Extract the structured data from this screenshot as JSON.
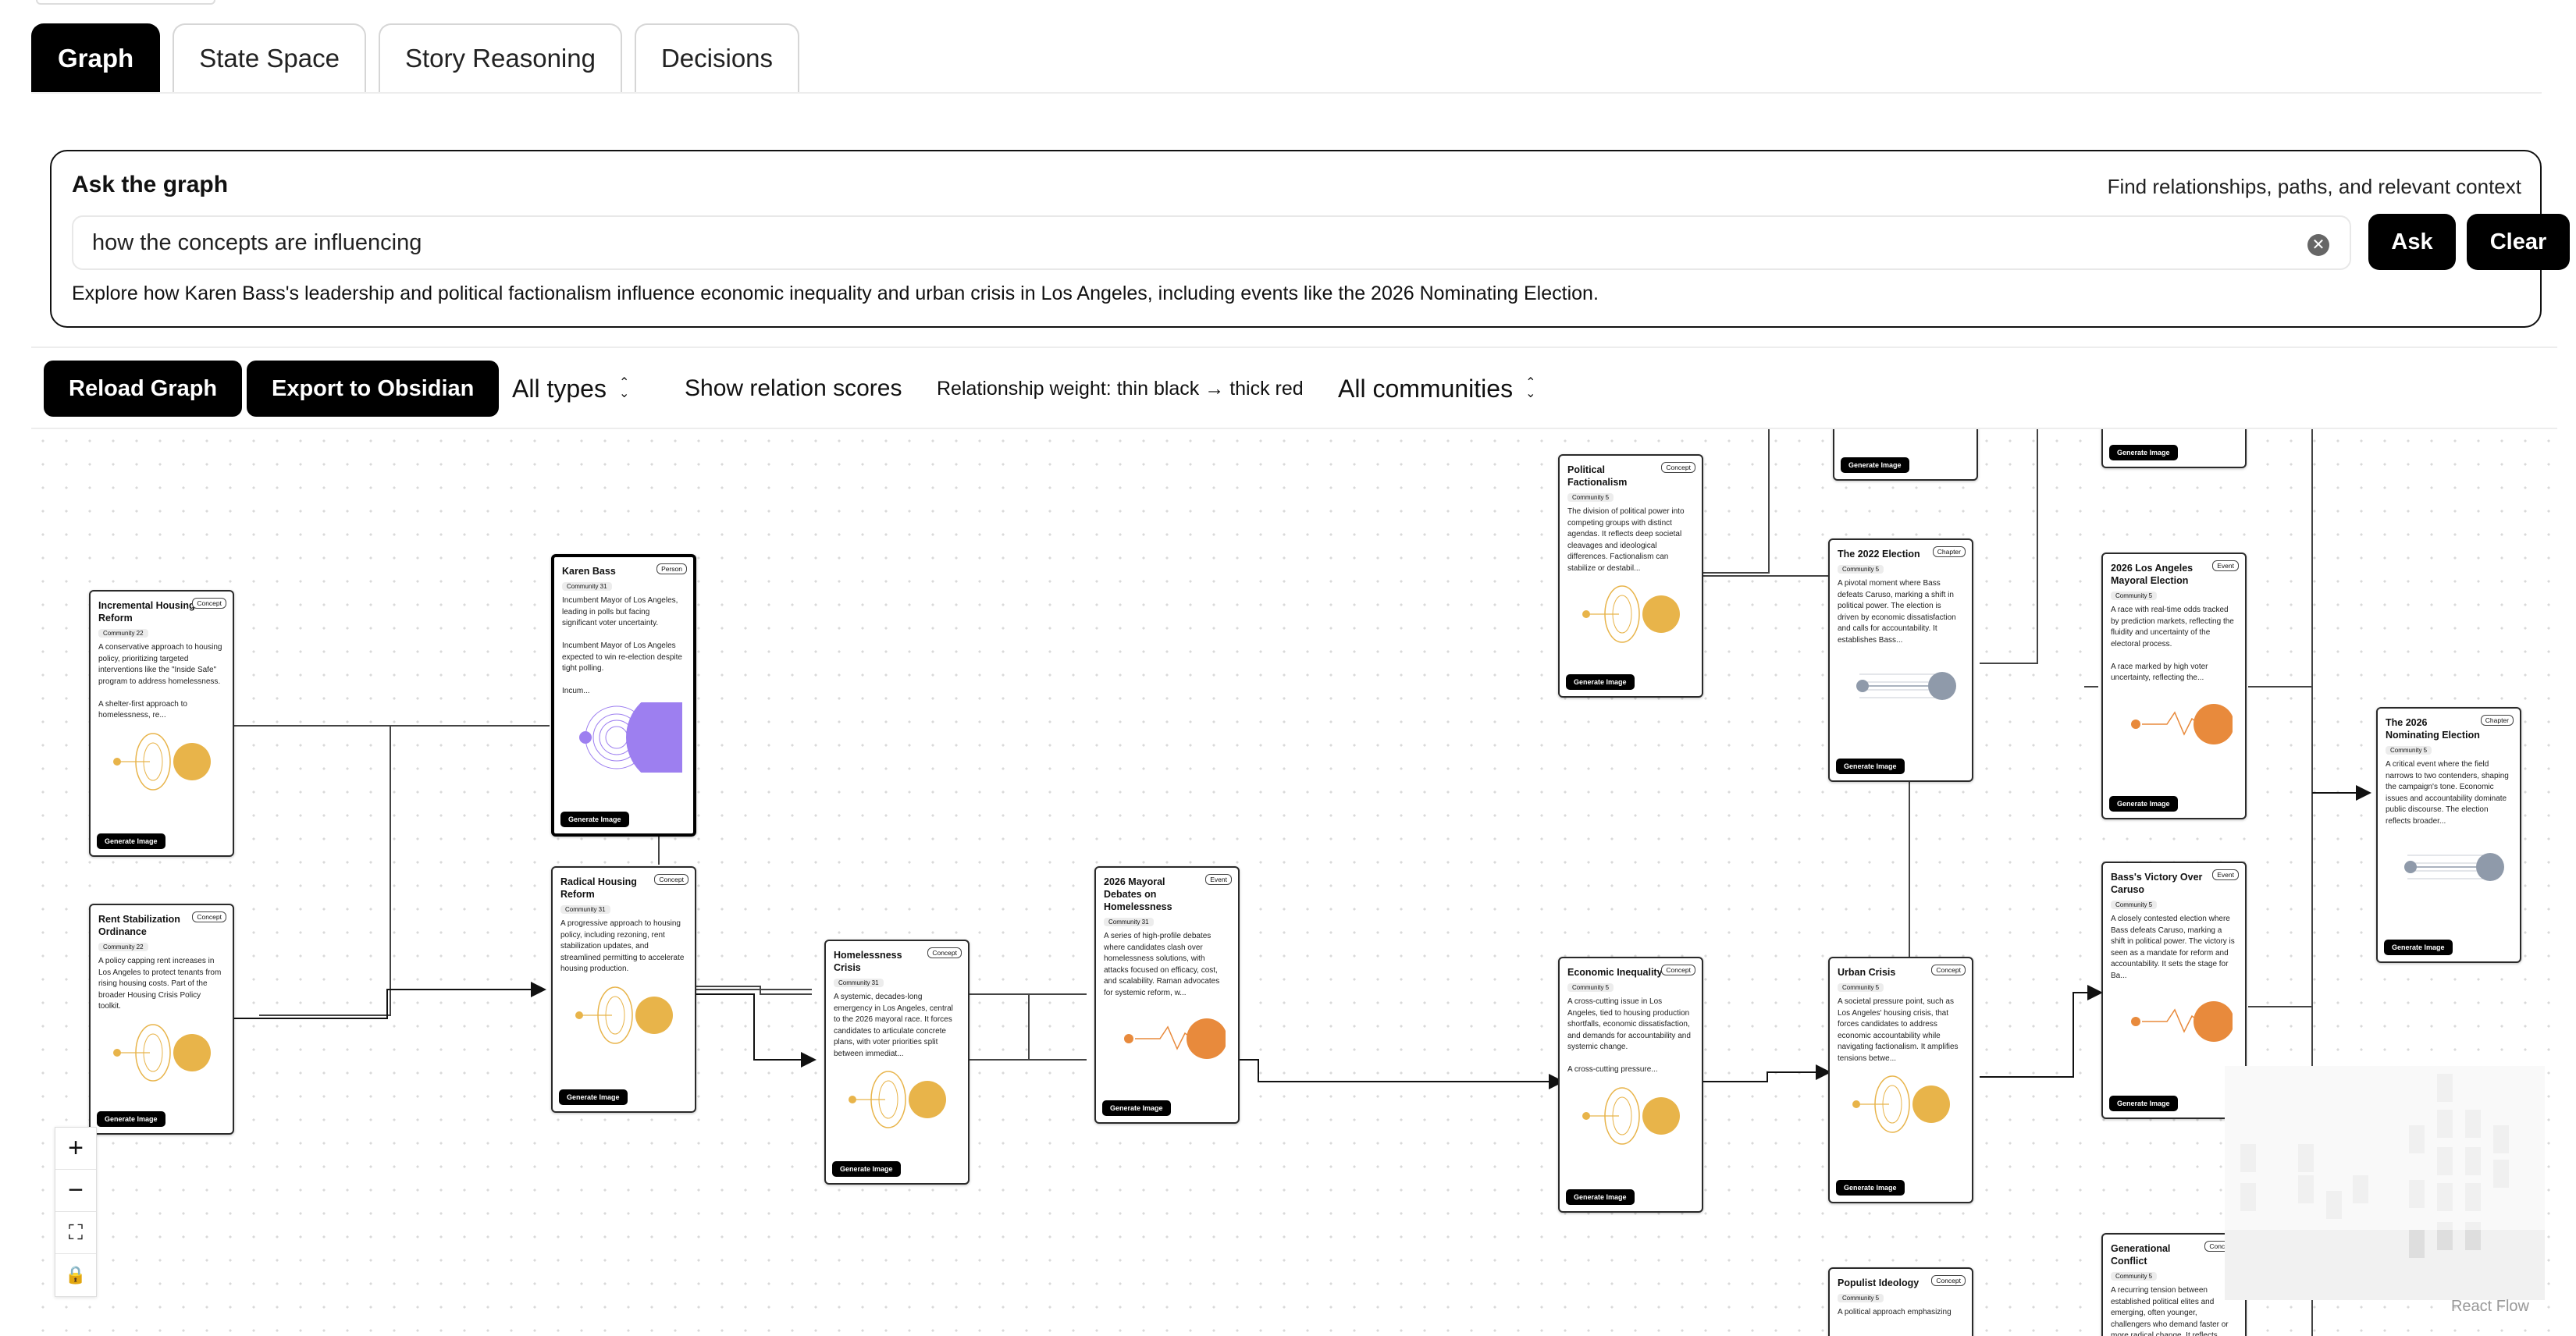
{
  "tabs": [
    {
      "label": "Graph",
      "active": true
    },
    {
      "label": "State Space"
    },
    {
      "label": "Story Reasoning"
    },
    {
      "label": "Decisions"
    }
  ],
  "ask": {
    "title": "Ask the graph",
    "hint": "Find relationships, paths, and relevant context",
    "query": "how the concepts are influencing",
    "ask_label": "Ask",
    "clear_label": "Clear",
    "summary": "Explore how Karen Bass's leadership and political factionalism influence economic inequality and urban crisis in Los Angeles, including events like the 2026 Nominating Election."
  },
  "toolbar": {
    "reload": "Reload Graph",
    "export": "Export to Obsidian",
    "types": "All types",
    "scores": "Show relation scores",
    "weight": "Relationship weight: thin black → thick red",
    "communities": "All communities"
  },
  "colors": {
    "orange": "#e8b44a",
    "deep_orange": "#e88a3c",
    "purple": "#9d7ff0",
    "slate": "#8f9aaa"
  },
  "nodes": [
    {
      "title": "Incremental Housing Reform",
      "type": "Concept",
      "community": "Community 22",
      "desc": "A conservative approach to housing policy, prioritizing targeted interventions like the \"Inside Safe\" program to address homelessness.\n\nA shelter-first approach to homelessness, re...",
      "art": "orange",
      "button": "Generate Image"
    },
    {
      "title": "Rent Stabilization Ordinance",
      "type": "Concept",
      "community": "Community 22",
      "desc": "A policy capping rent increases in Los Angeles to protect tenants from rising housing costs. Part of the broader Housing Crisis Policy toolkit.",
      "art": "orange",
      "button": "Generate Image"
    },
    {
      "title": "Karen Bass",
      "type": "Person",
      "community": "Community 31",
      "desc": "Incumbent Mayor of Los Angeles, leading in polls but facing significant voter uncertainty.\n\nIncumbent Mayor of Los Angeles expected to win re-election despite tight polling.\n\nIncum...",
      "art": "purple",
      "button": "Generate Image"
    },
    {
      "title": "Radical Housing Reform",
      "type": "Concept",
      "community": "Community 31",
      "desc": "A progressive approach to housing policy, including rezoning, rent stabilization updates, and streamlined permitting to accelerate housing production.",
      "art": "orange",
      "button": "Generate Image"
    },
    {
      "title": "Homelessness Crisis",
      "type": "Concept",
      "community": "Community 31",
      "desc": "A systemic, decades-long emergency in Los Angeles, central to the 2026 mayoral race. It forces candidates to articulate concrete plans, with voter priorities split between immediat...",
      "art": "orange",
      "button": "Generate Image"
    },
    {
      "title": "2026 Mayoral Debates on Homelessness",
      "type": "Event",
      "community": "Community 31",
      "desc": "A series of high-profile debates where candidates clash over homelessness solutions, with attacks focused on efficacy, cost, and scalability. Raman advocates for systemic reform, w...",
      "art": "wave",
      "button": "Generate Image"
    },
    {
      "title": "Political Factionalism",
      "type": "Concept",
      "community": "Community 5",
      "desc": "The division of political power into competing groups with distinct agendas. It reflects deep societal cleavages and ideological differences. Factionalism can stabilize or destabil...",
      "art": "orange",
      "button": "Generate Image"
    },
    {
      "title": "Economic Inequality",
      "type": "Concept",
      "community": "Community 5",
      "desc": "A cross-cutting issue in Los Angeles, tied to housing production shortfalls, economic dissatisfaction, and demands for accountability and systemic change.\n\nA cross-cutting pressure...",
      "art": "orange",
      "button": "Generate Image"
    },
    {
      "title": "The 2022 Election",
      "type": "Chapter",
      "community": "Community 5",
      "desc": "A pivotal moment where Bass defeats Caruso, marking a shift in political power. The election is driven by economic dissatisfaction and calls for accountability. It establishes Bass...",
      "art": "slate",
      "button": "Generate Image"
    },
    {
      "title": "Urban Crisis",
      "type": "Concept",
      "community": "Community 5",
      "desc": "A societal pressure point, such as Los Angeles' housing crisis, that forces candidates to address economic accountability while navigating factionalism. It amplifies tensions betwe...",
      "art": "orange",
      "button": "Generate Image"
    },
    {
      "title": "Populist Ideology",
      "type": "Concept",
      "community": "Community 5",
      "desc": "A political approach emphasizing",
      "art": "none",
      "button": ""
    },
    {
      "title": "2026 Los Angeles Mayoral Election",
      "type": "Event",
      "community": "Community 5",
      "desc": "A race with real-time odds tracked by prediction markets, reflecting the fluidity and uncertainty of the electoral process.\n\nA race marked by high voter uncertainty, reflecting the...",
      "art": "wave",
      "button": "Generate Image"
    },
    {
      "title": "Bass's Victory Over Caruso",
      "type": "Event",
      "community": "Community 5",
      "desc": "A closely contested election where Bass defeats Caruso, marking a shift in political power. The victory is seen as a mandate for reform and accountability. It sets the stage for Ba...",
      "art": "wave",
      "button": "Generate Image"
    },
    {
      "title": "Generational Conflict",
      "type": "Concept",
      "community": "Community 5",
      "desc": "A recurring tension between established political elites and emerging, often younger, challengers who demand faster or more radical change. It reflects",
      "art": "none",
      "button": ""
    },
    {
      "title": "The 2026 Nominating Election",
      "type": "Chapter",
      "community": "Community 5",
      "desc": "A critical event where the field narrows to two contenders, shaping the campaign's tone. Economic issues and accountability dominate public discourse. The election reflects broader...",
      "art": "slate",
      "button": "Generate Image"
    }
  ],
  "partial": {
    "button": "Generate Image"
  },
  "controls": {
    "zoom_in": "+",
    "zoom_out": "−",
    "fit": "⛶",
    "lock": "🔒"
  },
  "attribution": "React Flow"
}
